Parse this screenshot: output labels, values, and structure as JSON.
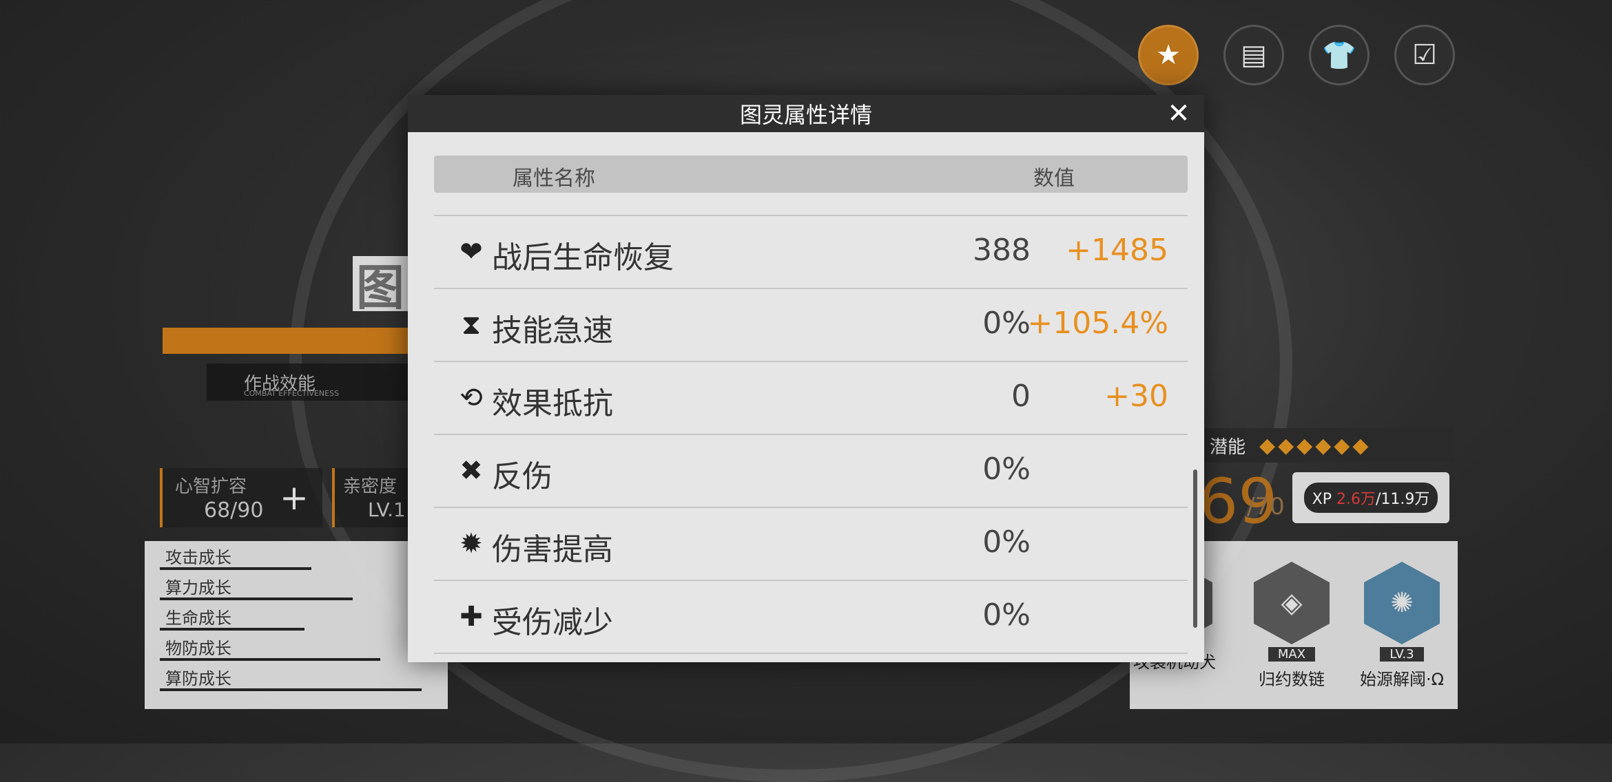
{
  "top_icons": [
    {
      "name": "favorite-icon",
      "glyph": "★"
    },
    {
      "name": "profile-doc-icon",
      "glyph": "▤"
    },
    {
      "name": "outfit-icon",
      "glyph": "👕"
    },
    {
      "name": "checklist-icon",
      "glyph": "☑"
    }
  ],
  "background": {
    "name_char": "图",
    "combat_label": "作战效能",
    "combat_sub": "COMBAT EFFECTIVENESS",
    "mind_label": "心智扩容",
    "mind_value": "68/90",
    "affinity_label": "亲密度",
    "affinity_value": "LV.1",
    "growth": [
      "攻击成长",
      "算力成长",
      "生命成长",
      "物防成长",
      "算防成长"
    ],
    "potential_label": "潜能",
    "potential_diamonds": "◆◆◆◆◆◆",
    "level_big": "69",
    "level_max": "/70",
    "xp_current": "2.6万",
    "xp_total": "/11.9万",
    "skills": [
      {
        "name": "攻袭机动犬",
        "tag": ""
      },
      {
        "name": "归约数链",
        "tag": "MAX"
      },
      {
        "name": "始源解阈·Ω",
        "tag": "LV.3"
      }
    ]
  },
  "modal": {
    "title": "图灵属性详情",
    "close_glyph": "✕",
    "col_name": "属性名称",
    "col_value": "数值",
    "rows": [
      {
        "icon": "heart-plus-icon",
        "glyph": "❤",
        "label": "战后生命恢复",
        "base": "388",
        "bonus": "+1485"
      },
      {
        "icon": "hourglass-icon",
        "glyph": "⧗",
        "label": "技能急速",
        "base": "0%",
        "bonus": "+105.4%"
      },
      {
        "icon": "resist-icon",
        "glyph": "⟲",
        "label": "效果抵抗",
        "base": "0",
        "bonus": "+30"
      },
      {
        "icon": "reflect-icon",
        "glyph": "✖",
        "label": "反伤",
        "base": "0%",
        "bonus": ""
      },
      {
        "icon": "damage-up-icon",
        "glyph": "✹",
        "label": "伤害提高",
        "base": "0%",
        "bonus": ""
      },
      {
        "icon": "damage-reduce-icon",
        "glyph": "✚",
        "label": "受伤减少",
        "base": "0%",
        "bonus": ""
      }
    ]
  }
}
